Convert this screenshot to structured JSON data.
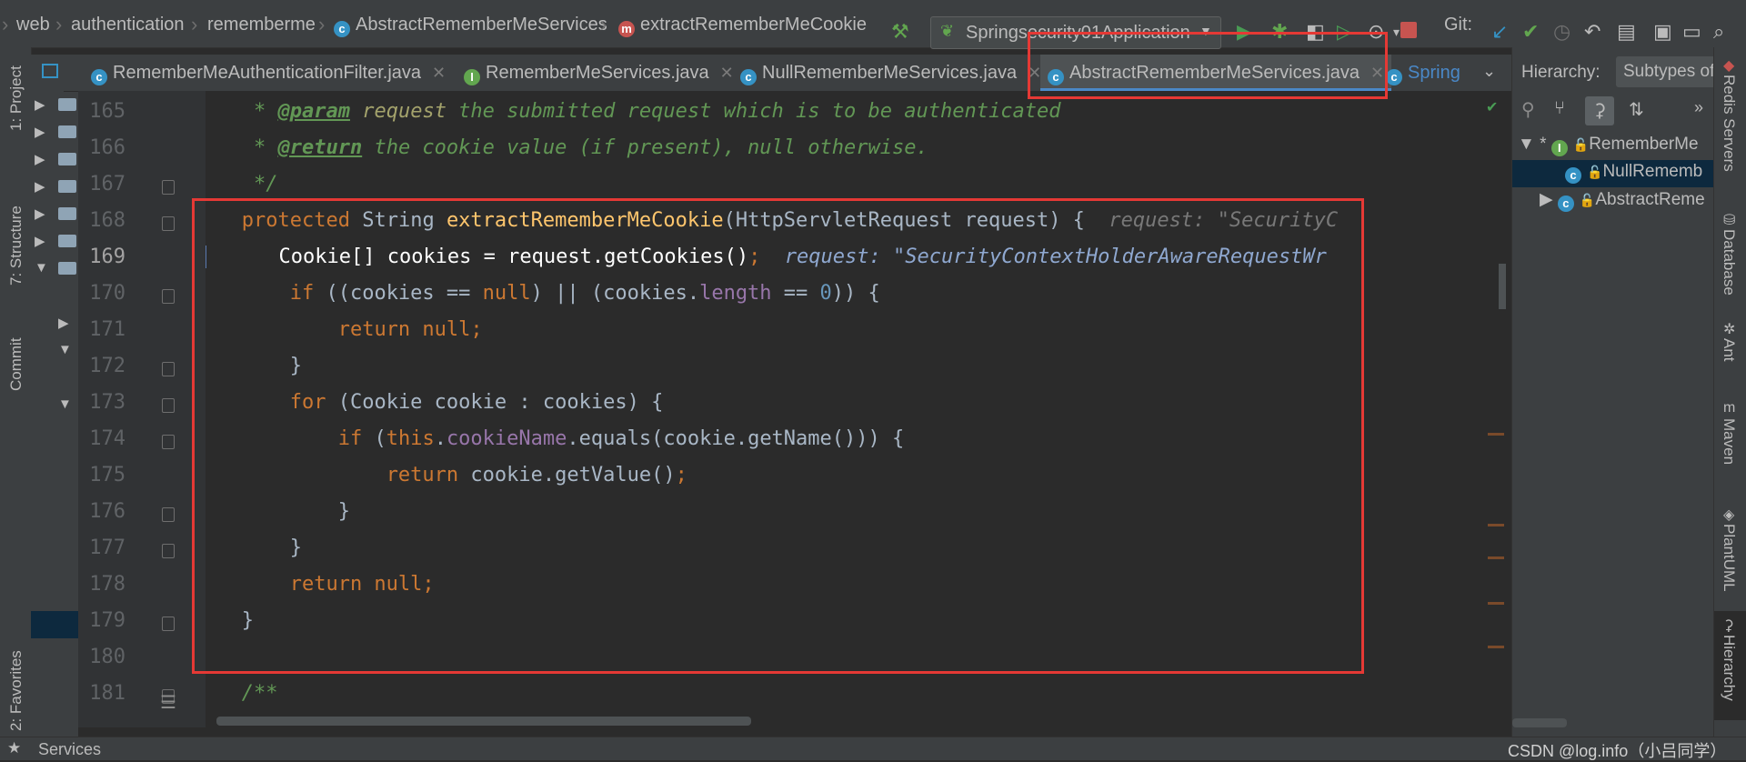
{
  "breadcrumb": {
    "items": [
      "web",
      "authentication",
      "rememberme",
      "AbstractRememberMeServices",
      "extractRememberMeCookie"
    ]
  },
  "toolbar": {
    "run_config": "Springsecurity01Application",
    "git_label": "Git:"
  },
  "tabs": [
    {
      "label": "RememberMeAuthenticationFilter.java",
      "icon": "C"
    },
    {
      "label": "RememberMeServices.java",
      "icon": "I"
    },
    {
      "label": "NullRememberMeServices.java",
      "icon": "C"
    },
    {
      "label": "AbstractRememberMeServices.java",
      "icon": "C",
      "active": true
    },
    {
      "label": "Spring",
      "icon": "C"
    }
  ],
  "project_tab_fragment": "P",
  "left_strip": {
    "project": "1: Project",
    "structure": "7: Structure",
    "commit": "Commit",
    "favorites": "2: Favorites"
  },
  "editor": {
    "lines": [
      {
        "n": "165"
      },
      {
        "n": "166"
      },
      {
        "n": "167"
      },
      {
        "n": "168"
      },
      {
        "n": "169"
      },
      {
        "n": "170"
      },
      {
        "n": "171"
      },
      {
        "n": "172"
      },
      {
        "n": "173"
      },
      {
        "n": "174"
      },
      {
        "n": "175"
      },
      {
        "n": "176"
      },
      {
        "n": "177"
      },
      {
        "n": "178"
      },
      {
        "n": "179"
      },
      {
        "n": "180"
      },
      {
        "n": "181"
      }
    ],
    "doc_param_tag": "@param",
    "doc_param_name": "request",
    "doc_param_text": " the submitted request which is to be authenticated",
    "doc_return_tag": "@return",
    "doc_return_text": " the cookie value (if present), null otherwise.",
    "doc_end": "*/",
    "hint_168": "request: \"SecurityC",
    "hint_169": "request: \"SecurityContextHolderAwareRequestWr",
    "doc_start": "/**"
  },
  "hierarchy": {
    "title": "Hierarchy:",
    "tab": "Subtypes of",
    "items": [
      {
        "label": "RememberMe",
        "icon": "I"
      },
      {
        "label": "NullRememb",
        "icon": "C"
      },
      {
        "label": "AbstractReme",
        "icon": "C"
      }
    ]
  },
  "right_strip": {
    "redis": "Redis Servers",
    "database": "Database",
    "ant": "Ant",
    "maven": "Maven",
    "plantuml": "PlantUML",
    "hierarchy": "Hierarchy"
  },
  "status": {
    "services": "Services",
    "watermark": "CSDN @log.info（小吕同学）"
  },
  "colors": {
    "accent": "#4a88c7",
    "highlight": "#2d5b9e",
    "annotation_box": "#e53935"
  }
}
